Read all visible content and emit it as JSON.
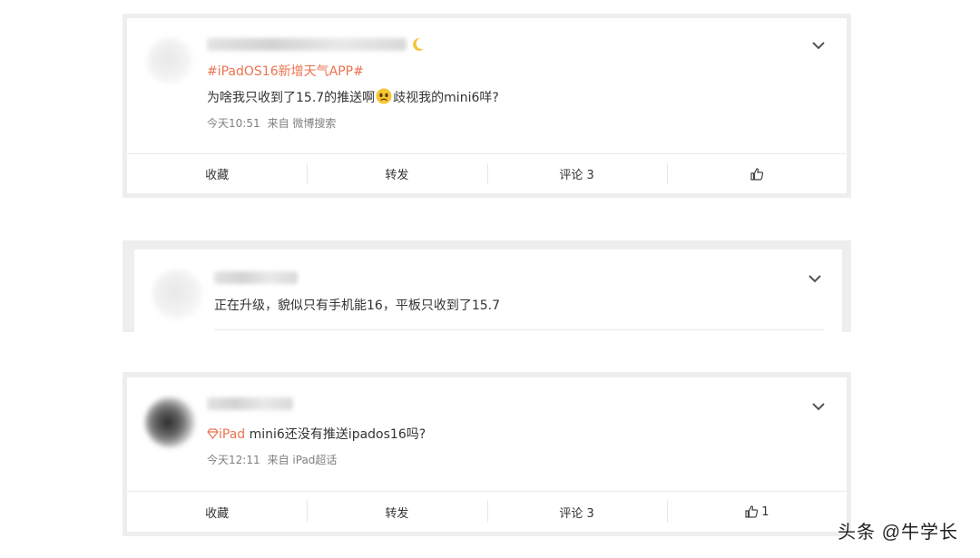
{
  "posts": [
    {
      "topic": "#iPadOS16新增天气APP#",
      "text_before": "为啥我只收到了15.7的推送啊",
      "text_after": "歧视我的mini6咩?",
      "time": "今天10:51",
      "source": "来自 微博搜索",
      "actions": {
        "fav": "收藏",
        "repost": "转发",
        "comment": "评论 3",
        "like": ""
      }
    },
    {
      "text": "正在升级，貌似只有手机能16，平板只收到了15.7"
    },
    {
      "topic": "iPad",
      "text": " mini6还没有推送ipados16吗?",
      "time": "今天12:11",
      "source": "来自 iPad超话",
      "actions": {
        "fav": "收藏",
        "repost": "转发",
        "comment": "评论 3",
        "like": "1"
      }
    }
  ],
  "watermark": "头条 @牛学长",
  "colors": {
    "topic": "#eb7350",
    "meta": "#808080",
    "frame": "#eeeeee"
  },
  "icons": [
    "chevron-down-icon",
    "thumbs-up-icon",
    "sad-emoji-icon",
    "moon-icon",
    "super-topic-icon"
  ]
}
